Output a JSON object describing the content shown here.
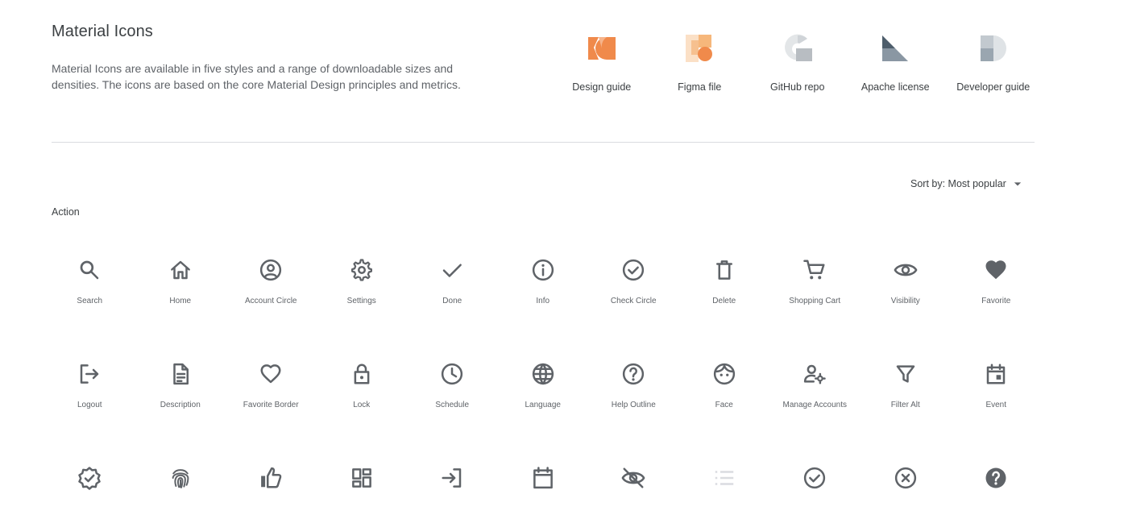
{
  "header": {
    "title": "Material Icons",
    "description": "Material Icons are available in five styles and a range of downloadable sizes and densities. The icons are based on the core Material Design principles and metrics."
  },
  "resources": [
    {
      "label": "Design guide",
      "icon": "design-guide-icon"
    },
    {
      "label": "Figma file",
      "icon": "figma-file-icon"
    },
    {
      "label": "GitHub repo",
      "icon": "github-repo-icon"
    },
    {
      "label": "Apache license",
      "icon": "apache-license-icon"
    },
    {
      "label": "Developer guide",
      "icon": "developer-guide-icon"
    }
  ],
  "sort": {
    "label": "Sort by: Most popular",
    "icon": "arrow-drop-down-icon"
  },
  "category": {
    "label": "Action"
  },
  "icons": [
    {
      "label": "Search",
      "icon": "search-icon"
    },
    {
      "label": "Home",
      "icon": "home-icon"
    },
    {
      "label": "Account Circle",
      "icon": "account-circle-icon"
    },
    {
      "label": "Settings",
      "icon": "settings-icon"
    },
    {
      "label": "Done",
      "icon": "done-icon"
    },
    {
      "label": "Info",
      "icon": "info-icon"
    },
    {
      "label": "Check Circle",
      "icon": "check-circle-icon"
    },
    {
      "label": "Delete",
      "icon": "delete-icon"
    },
    {
      "label": "Shopping Cart",
      "icon": "shopping-cart-icon"
    },
    {
      "label": "Visibility",
      "icon": "visibility-icon"
    },
    {
      "label": "Favorite",
      "icon": "favorite-icon"
    },
    {
      "label": "Logout",
      "icon": "logout-icon"
    },
    {
      "label": "Description",
      "icon": "description-icon"
    },
    {
      "label": "Favorite Border",
      "icon": "favorite-border-icon"
    },
    {
      "label": "Lock",
      "icon": "lock-icon"
    },
    {
      "label": "Schedule",
      "icon": "schedule-icon"
    },
    {
      "label": "Language",
      "icon": "language-icon"
    },
    {
      "label": "Help Outline",
      "icon": "help-outline-icon"
    },
    {
      "label": "Face",
      "icon": "face-icon"
    },
    {
      "label": "Manage Accounts",
      "icon": "manage-accounts-icon"
    },
    {
      "label": "Filter Alt",
      "icon": "filter-alt-icon"
    },
    {
      "label": "Event",
      "icon": "event-icon"
    },
    {
      "label": "",
      "icon": "verified-icon"
    },
    {
      "label": "",
      "icon": "fingerprint-icon"
    },
    {
      "label": "",
      "icon": "thumb-up-icon"
    },
    {
      "label": "",
      "icon": "dashboard-icon"
    },
    {
      "label": "",
      "icon": "login-icon"
    },
    {
      "label": "",
      "icon": "calendar-today-icon"
    },
    {
      "label": "",
      "icon": "visibility-off-icon"
    },
    {
      "label": "",
      "icon": "list-icon"
    },
    {
      "label": "",
      "icon": "check-circle-outline-icon"
    },
    {
      "label": "",
      "icon": "highlight-off-icon"
    },
    {
      "label": "",
      "icon": "help-icon"
    }
  ]
}
